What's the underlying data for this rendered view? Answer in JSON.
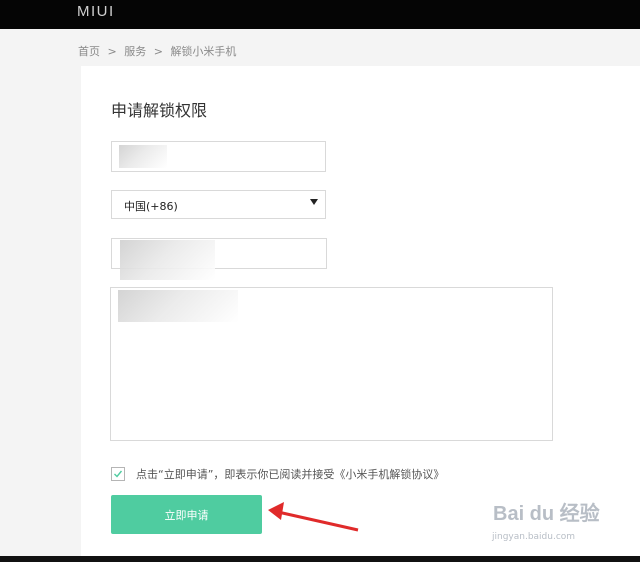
{
  "header": {
    "brand": "MIUI"
  },
  "breadcrumb": {
    "home": "首页",
    "sep1": ">",
    "service": "服务",
    "sep2": ">",
    "current": "解锁小米手机"
  },
  "form": {
    "title": "申请解锁权限",
    "name_value": "",
    "country_code": "中国(+86)",
    "phone_value": "",
    "reason_value": "",
    "agree_prefix": "点击“立即申请”，即表示你已阅读并接受",
    "agree_link": "《小米手机解锁协议》",
    "agree_checked": true,
    "submit_label": "立即申请"
  },
  "watermark": {
    "logo": "Bai du 经验",
    "url": "jingyan.baidu.com"
  },
  "colors": {
    "accent": "#4fcca0",
    "annotation_arrow": "#e02a2a"
  }
}
